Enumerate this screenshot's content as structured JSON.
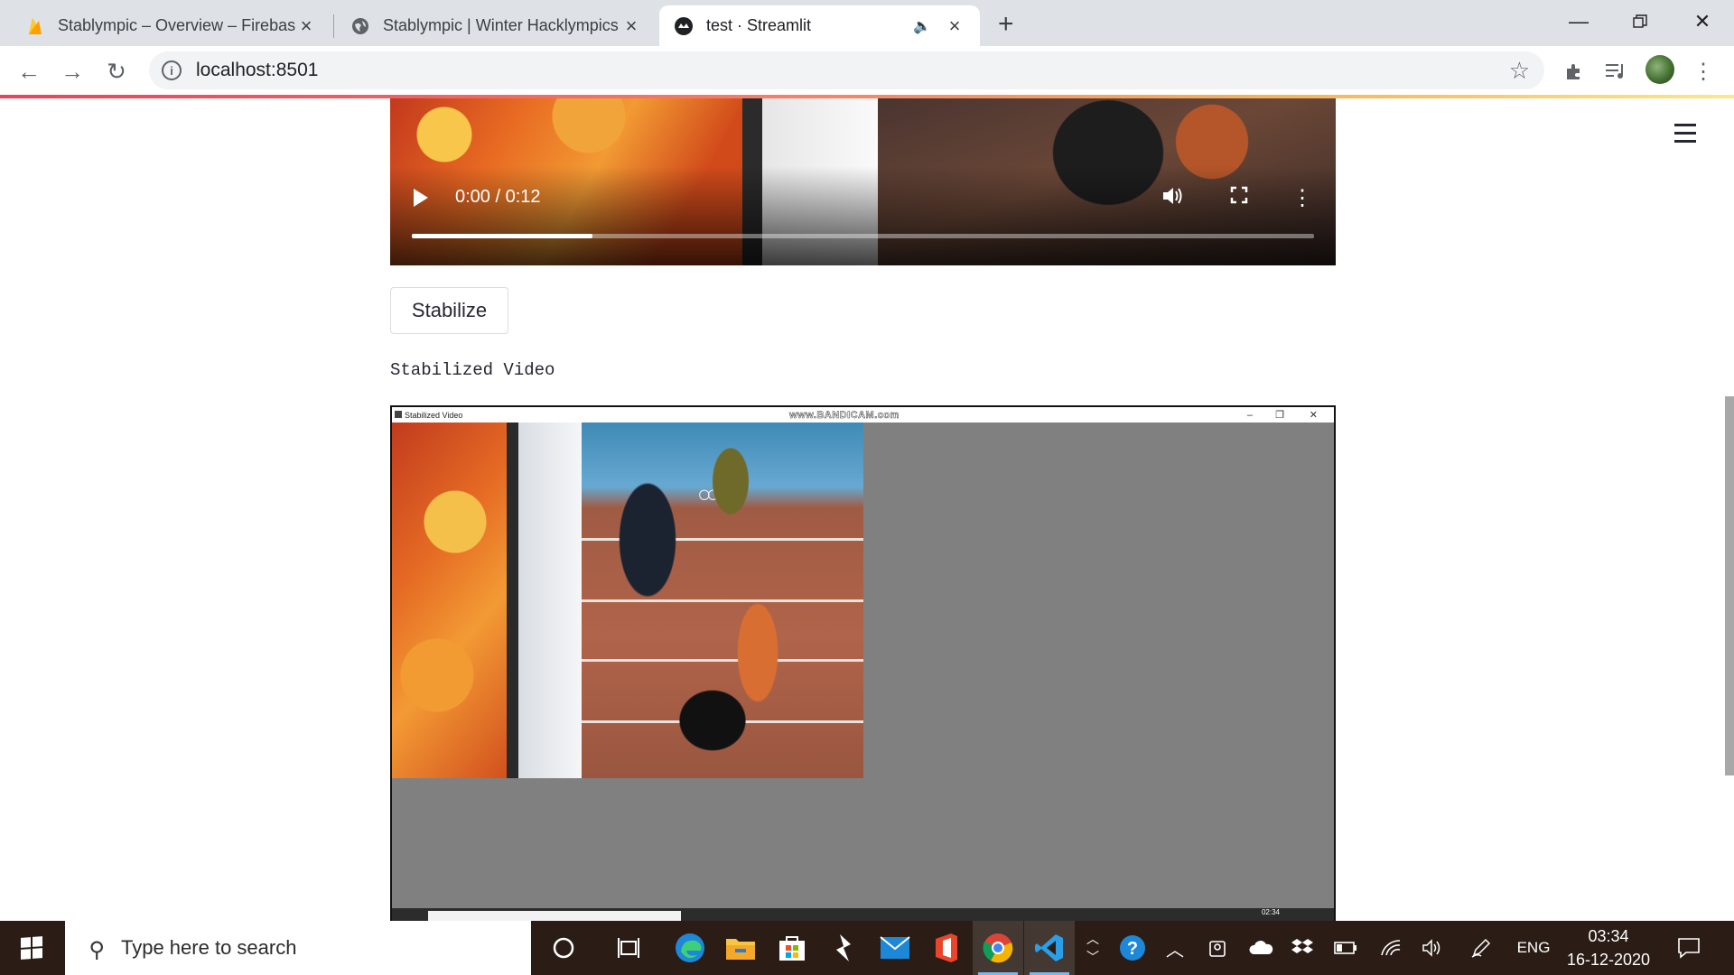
{
  "browser": {
    "tabs": [
      {
        "title": "Stablympic – Overview – Firebase console",
        "favicon": "firebase-icon"
      },
      {
        "title": "Stablympic | Winter Hacklympics",
        "favicon": "globe-icon"
      },
      {
        "title": "test · Streamlit",
        "favicon": "streamlit-icon",
        "active": true
      }
    ],
    "url": "localhost:8501"
  },
  "video_player": {
    "time": "0:00 / 0:12",
    "progress_fraction": 0.2
  },
  "stabilize_button": {
    "label": "Stabilize"
  },
  "stabilized_label": "Stabilized Video",
  "capture": {
    "window_title": "Stabilized Video",
    "watermark": "www.BANDICAM.com",
    "clock": "02:34"
  },
  "taskbar": {
    "search_placeholder": "Type here to search",
    "language": "ENG",
    "time": "03:34",
    "date": "16-12-2020"
  },
  "colors": {
    "accent_progress": "#e9435a",
    "taskbar_bg": "#2b1d16"
  }
}
